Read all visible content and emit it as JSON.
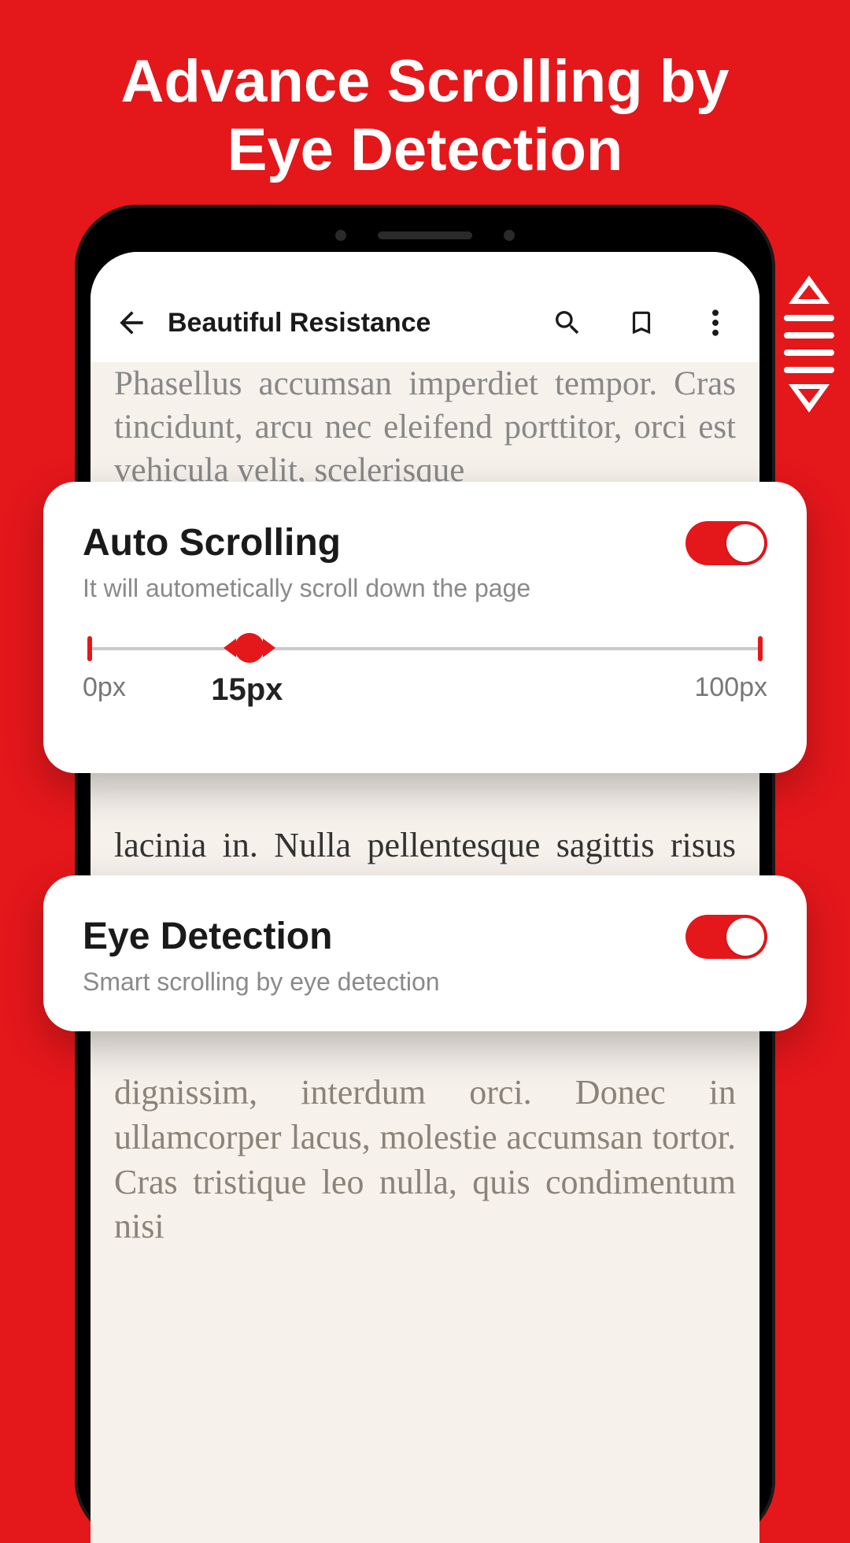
{
  "hero": {
    "title_line1": "Advance Scrolling by",
    "title_line2": "Eye Detection"
  },
  "app": {
    "document_title": "Beautiful Resistance",
    "body_text_1": "Phasellus accumsan imperdiet tempor. Cras tincidunt, arcu nec eleifend porttitor, orci est vehicula velit, scelerisque",
    "body_text_2": "lacinia in. Nulla pellentesque sagittis risus vel dapibus. Curabitur eget ex nec lacus",
    "body_text_3": "dignissim, interdum orci. Donec in ullamcorper lacus, molestie accumsan tortor. Cras tristique leo nulla, quis condimentum nisi"
  },
  "auto_scroll": {
    "title": "Auto Scrolling",
    "subtitle": "It will autometically scroll down the page",
    "enabled": true,
    "slider": {
      "min_label": "0px",
      "value_label": "15px",
      "max_label": "100px",
      "value": 15,
      "min": 0,
      "max": 100
    }
  },
  "eye_detection": {
    "title": "Eye Detection",
    "subtitle": "Smart scrolling by eye detection",
    "enabled": true
  },
  "colors": {
    "brand_red": "#e4171b"
  }
}
